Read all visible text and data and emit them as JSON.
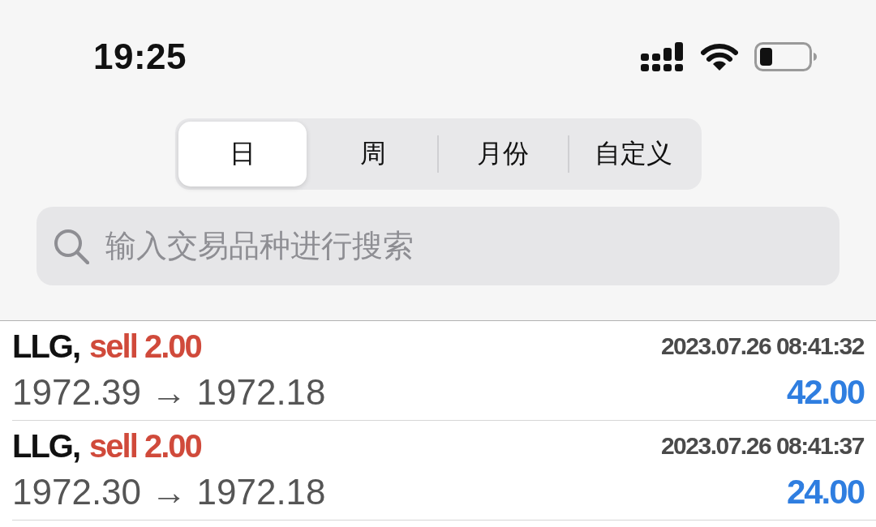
{
  "status_bar": {
    "time": "19:25"
  },
  "period_tabs": [
    {
      "label": "日",
      "selected": true
    },
    {
      "label": "周",
      "selected": false
    },
    {
      "label": "月份",
      "selected": false
    },
    {
      "label": "自定义",
      "selected": false
    }
  ],
  "search": {
    "placeholder": "输入交易品种进行搜索"
  },
  "trades": [
    {
      "symbol": "LLG,",
      "kind": "sell",
      "order": "sell 2.00",
      "time": "2023.07.26 08:41:32",
      "prices": "1972.39 → 1972.18",
      "profit": "42.00"
    },
    {
      "symbol": "LLG,",
      "kind": "sell",
      "order": "sell 2.00",
      "time": "2023.07.26 08:41:37",
      "prices": "1972.30 → 1972.18",
      "profit": "24.00"
    }
  ]
}
